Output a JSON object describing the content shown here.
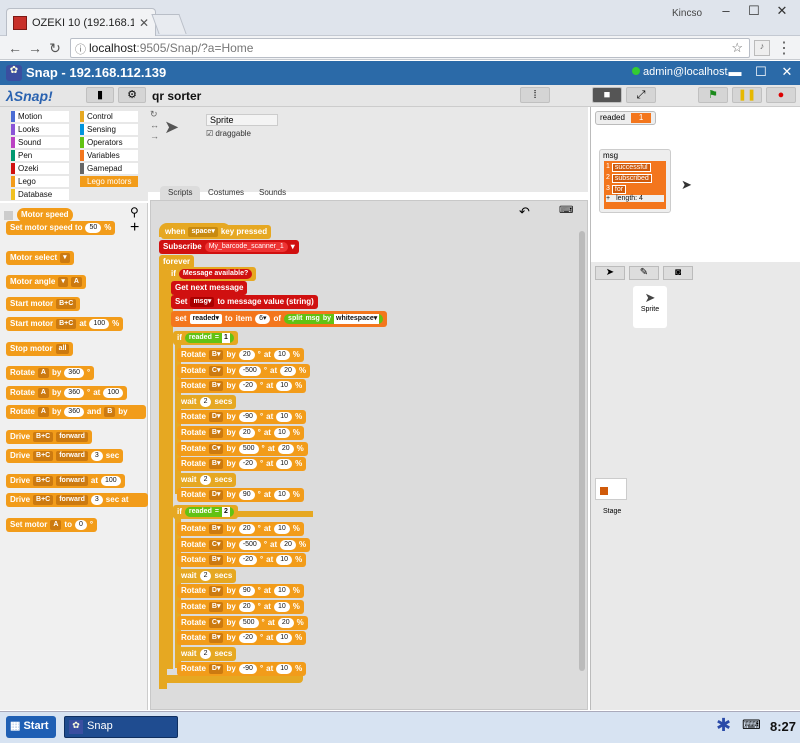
{
  "browser": {
    "tab_title": "OZEKI 10 (192.168.112.1:",
    "user_label": "Kincso",
    "url_host": "localhost",
    "url_path": ":9505/Snap/?a=Home"
  },
  "snap": {
    "window_title": "Snap - 192.168.112.139",
    "user": "admin@localhost",
    "logo_text": "λSnap!",
    "project_name": "qr  sorter",
    "categories": [
      {
        "label": "Motion",
        "color": "#4a6cd4"
      },
      {
        "label": "Control",
        "color": "#e6a822"
      },
      {
        "label": "Looks",
        "color": "#8a55d7"
      },
      {
        "label": "Sensing",
        "color": "#0094dd"
      },
      {
        "label": "Sound",
        "color": "#bb42c3"
      },
      {
        "label": "Operators",
        "color": "#62c213"
      },
      {
        "label": "Pen",
        "color": "#009870"
      },
      {
        "label": "Variables",
        "color": "#f3761d"
      },
      {
        "label": "Ozeki",
        "color": "#d01010"
      },
      {
        "label": "Gamepad",
        "color": "#666666"
      },
      {
        "label": "Lego",
        "color": "#f29c1a"
      },
      {
        "label": "Lego motors",
        "color": "#f29c1a"
      },
      {
        "label": "Database",
        "color": "#f0c020"
      }
    ],
    "palette": {
      "motor_speed": "Motor speed",
      "set_motor_speed": "Set motor speed to",
      "set_motor_speed_val": "50",
      "percent": "%",
      "motor_select": "Motor select",
      "motor_angle": "Motor angle",
      "a": "A",
      "start_motor": "Start motor",
      "bc": "B+C",
      "at": "at",
      "hundred": "100",
      "stop_motor": "Stop motor",
      "all": "all",
      "rotate": "Rotate",
      "by": "by",
      "three_sixty": "360",
      "degree": "°",
      "and": "and",
      "b": "B",
      "drive": "Drive",
      "forward": "forward",
      "three": "3",
      "sec": "sec",
      "sec_at": "sec at",
      "set_motor": "Set motor",
      "to": "to",
      "zero": "0"
    },
    "sprite": {
      "name": "Sprite",
      "draggable": "draggable"
    },
    "tabs": [
      "Scripts",
      "Costumes",
      "Sounds"
    ],
    "script": {
      "hat": "when",
      "space": "space",
      "key_pressed": "key pressed",
      "subscribe": "Subscribe",
      "topic": "My_barcode_scanner_1",
      "forever": "forever",
      "if": "if",
      "message_available": "Message available?",
      "get_next": "Get next message",
      "set_msg": "Set",
      "msg": "msg",
      "to_msg_value": "to message value (string)",
      "set": "set",
      "readed": "readed",
      "to": "to",
      "item": "item",
      "six": "6",
      "of": "of",
      "split": "split",
      "by": "by",
      "whitespace": "whitespace",
      "eq": "=",
      "one": "1",
      "two": "2",
      "wait": "wait",
      "secs": "secs",
      "at": "at",
      "pct": "%",
      "deg": "°"
    },
    "stage": {
      "watcher_label": "readed",
      "watcher_value": "1",
      "list_name": "msg",
      "list_items": [
        "successful",
        "subscribed",
        "for"
      ],
      "list_indices": [
        "1",
        "2",
        "3"
      ],
      "list_length_label": "length: 4",
      "plus": "+"
    },
    "corral": {
      "sprite_label": "Sprite",
      "stage_label": "Stage"
    }
  },
  "taskbar": {
    "start": "Start",
    "app": "Snap",
    "clock": "8:27"
  }
}
